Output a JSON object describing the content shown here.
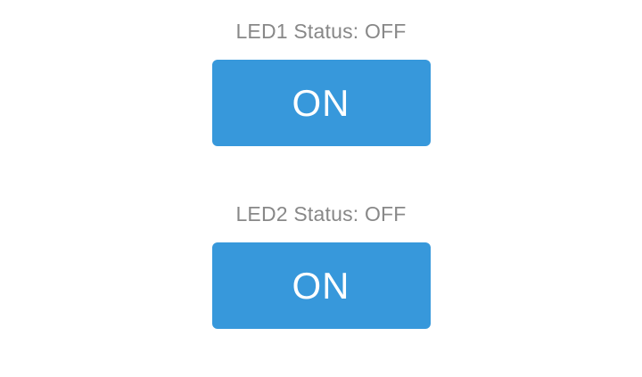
{
  "leds": [
    {
      "status_text": "LED1 Status: OFF",
      "button_label": "ON"
    },
    {
      "status_text": "LED2 Status: OFF",
      "button_label": "ON"
    }
  ],
  "colors": {
    "button_bg": "#3798db",
    "button_text": "#ffffff",
    "status_text": "#888888",
    "background": "#ffffff"
  }
}
